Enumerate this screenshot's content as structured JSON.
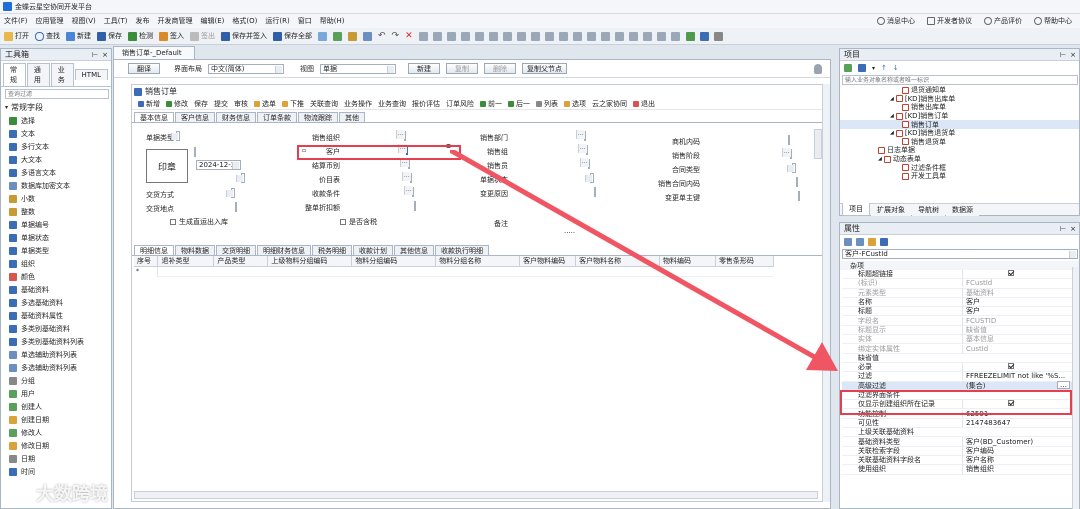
{
  "app": {
    "title": "金蝶云星空协同开发平台"
  },
  "menu": [
    "文件(F)",
    "应用管理",
    "视图(V)",
    "工具(T)",
    "发布",
    "开发商管理",
    "编辑(E)",
    "格式(O)",
    "运行(R)",
    "窗口",
    "帮助(H)"
  ],
  "menu_right": [
    "消息中心",
    "开发者协议",
    "产品评价",
    "帮助中心"
  ],
  "toolbar": [
    "打开",
    "查找",
    "新建",
    "保存",
    "检测",
    "签入",
    "签出",
    "保存并签入",
    "保存全部"
  ],
  "toolbox": {
    "title": "工具箱",
    "tabs": [
      "常规",
      "通用",
      "业务",
      "HTML"
    ],
    "filter_placeholder": "查询过滤",
    "section": "常规字段",
    "items": [
      "选择",
      "文本",
      "多行文本",
      "大文本",
      "多语言文本",
      "数据库加密文本",
      "小数",
      "整数",
      "单据编号",
      "单据状态",
      "单据类型",
      "组织",
      "颜色",
      "基础资料",
      "多选基础资料",
      "基础资料属性",
      "多类别基础资料",
      "多类别基础资料列表",
      "单选辅助资料列表",
      "多选辅助资料列表",
      "分组",
      "用户",
      "创建人",
      "创建日期",
      "修改人",
      "修改日期",
      "日期",
      "时间"
    ]
  },
  "doc_tab": "销售订单-_Default",
  "doc_toolbar": {
    "translate": "翻译",
    "layout_label": "界面布局",
    "layout_value": "中文(简体)",
    "view_label": "视图",
    "view_value": "单据",
    "new": "新建",
    "copy": "复制",
    "delete": "删除",
    "copy_node": "复制父节点"
  },
  "form": {
    "title": "销售订单",
    "actions": [
      "新增",
      "修改",
      "保存",
      "提交",
      "审核",
      "选单",
      "下推",
      "关联查询",
      "业务操作",
      "业务查询",
      "报价评估",
      "订单风险",
      "前一",
      "后一",
      "列表",
      "选项",
      "云之家协同",
      "退出"
    ],
    "tabs": [
      "基本信息",
      "客户信息",
      "财务信息",
      "订单条款",
      "物流跟踪",
      "其他"
    ],
    "stamp": "印章",
    "date_value": "2024-12-31",
    "left_labels": [
      "单据类型",
      "交货方式",
      "交货地点"
    ],
    "checkbox_label": "生成直运出入库",
    "col2_labels": [
      "销售组织",
      "客户",
      "结算币别",
      "价目表",
      "收款条件",
      "整单折扣额"
    ],
    "col2_check": "是否含税",
    "col3_labels": [
      "销售部门",
      "销售组",
      "销售员",
      "单据状态",
      "变更原因"
    ],
    "col3_note": "备注",
    "col4_labels": [
      "商机内码",
      "销售阶段",
      "合同类型",
      "销售合同内码",
      "变更单主键"
    ],
    "entry_tabs": [
      "明细信息",
      "物料数据",
      "交货明细",
      "明细财务信息",
      "税务明细",
      "收款计划",
      "其他信息",
      "收款执行明细"
    ],
    "grid_cols": [
      "序号",
      "退补类型",
      "产品类型",
      "上级物料分组编码",
      "物料分组编码",
      "物料分组名称",
      "客户物料编码",
      "客户物料名称",
      "物料编码",
      "零售条形码"
    ]
  },
  "project": {
    "title": "项目",
    "search_placeholder": "输入业务对象名称或者唯一标识",
    "tree": [
      "退货通知单",
      "[KD]销售出库单",
      "销售出库单",
      "[KD]销售订单",
      "销售订单",
      "[KD]销售退货单",
      "销售退货单",
      "日志单据",
      "动态表单",
      "过滤条件框",
      "开发工具单"
    ],
    "tabs": [
      "项目",
      "扩展对象",
      "导航树",
      "数据源"
    ]
  },
  "props": {
    "title": "属性",
    "selector": "客户-FCustId",
    "section": "杂项",
    "rows": [
      {
        "k": "标题超链接",
        "v": "",
        "chk": true,
        "gray": false
      },
      {
        "k": "(标识)",
        "v": "FCustId",
        "gray": true
      },
      {
        "k": "元素类型",
        "v": "基础资料",
        "gray": true
      },
      {
        "k": "名称",
        "v": "客户",
        "gray": false
      },
      {
        "k": "标题",
        "v": "客户",
        "gray": false
      },
      {
        "k": "字段名",
        "v": "FCUSTID",
        "gray": true
      },
      {
        "k": "标题显示",
        "v": "缺省值",
        "gray": true
      },
      {
        "k": "实体",
        "v": "基本信息",
        "gray": true
      },
      {
        "k": "绑定实体属性",
        "v": "CustId",
        "gray": true
      },
      {
        "k": "缺省值",
        "v": "",
        "gray": false
      },
      {
        "k": "必录",
        "v": "",
        "chk": true,
        "gray": false
      },
      {
        "k": "过滤",
        "v": "FFREEZELIMIT not like '%S...",
        "gray": false
      },
      {
        "k": "高级过滤",
        "v": "(集合)",
        "gray": false
      },
      {
        "k": "过滤界面条件",
        "v": "",
        "gray": false
      },
      {
        "k": "仅显示创建组织所在记录",
        "v": "",
        "chk": true,
        "gray": false
      },
      {
        "k": "功能控制",
        "v": "62591",
        "gray": false
      },
      {
        "k": "可见性",
        "v": "2147483647",
        "gray": false
      },
      {
        "k": "上级关联基础资料",
        "v": "",
        "gray": false
      },
      {
        "k": "基础资料类型",
        "v": "客户(BD_Customer)",
        "gray": false
      },
      {
        "k": "关联检索字段",
        "v": "客户编码",
        "gray": false
      },
      {
        "k": "关联基础资料字段名",
        "v": "客户名称",
        "gray": false
      },
      {
        "k": "使用组织",
        "v": "销售组织",
        "gray": false
      }
    ]
  },
  "watermark": "大数跨境"
}
